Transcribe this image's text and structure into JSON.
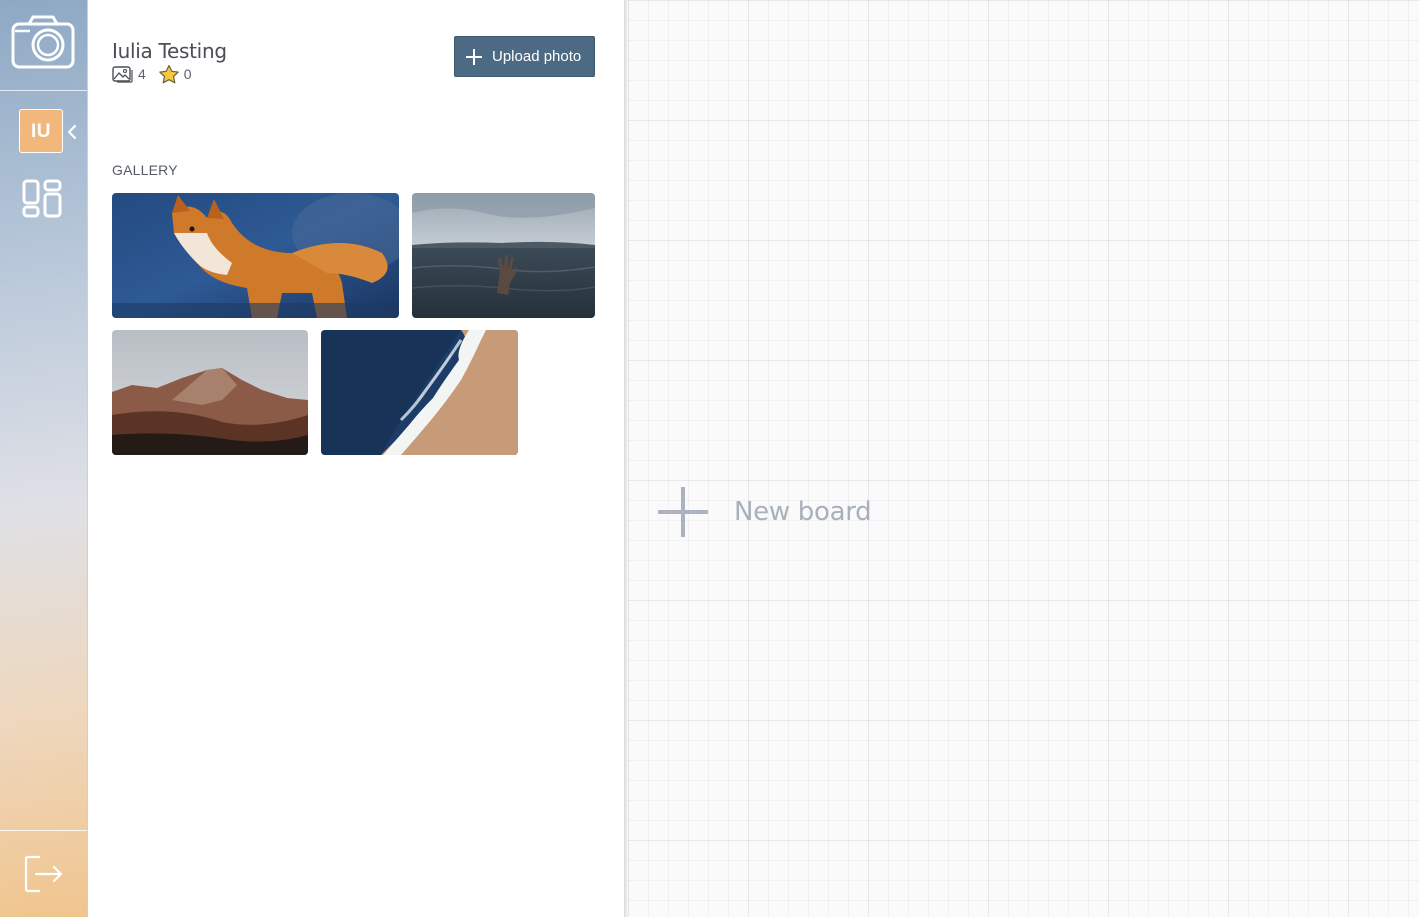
{
  "rail": {
    "logo_icon": "camera-icon",
    "avatar_initials": "IU",
    "collapse_icon": "chevron-left-icon",
    "boards_icon": "boards-grid-icon",
    "logout_icon": "logout-icon"
  },
  "profile": {
    "name": "Iulia Testing",
    "photo_count": "4",
    "favorite_count": "0",
    "photo_count_icon": "photos-icon",
    "favorite_count_icon": "star-icon"
  },
  "toolbar": {
    "upload_label": "Upload photo",
    "upload_icon": "plus-icon"
  },
  "gallery": {
    "title": "GALLERY",
    "photos": [
      {
        "subject": "fox"
      },
      {
        "subject": "hand-in-sea"
      },
      {
        "subject": "mountains"
      },
      {
        "subject": "ocean-waves"
      }
    ]
  },
  "board": {
    "new_board_label": "New board",
    "new_board_icon": "plus-icon"
  },
  "colors": {
    "accent": "#4d6a85",
    "avatar": "#f2b77a",
    "star": "#f5c842"
  }
}
